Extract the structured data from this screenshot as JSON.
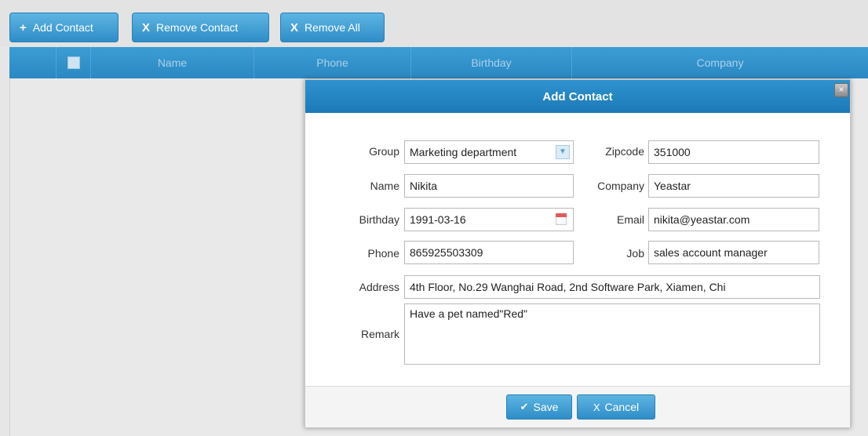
{
  "toolbar": {
    "add_contact": {
      "icon": "+",
      "label": "Add Contact"
    },
    "remove_contact": {
      "icon": "X",
      "label": "Remove Contact"
    },
    "remove_all": {
      "icon": "X",
      "label": "Remove All"
    }
  },
  "grid": {
    "columns": [
      "Name",
      "Phone",
      "Birthday",
      "Company"
    ]
  },
  "dialog": {
    "title": "Add Contact",
    "close_icon": "×",
    "fields": {
      "group": {
        "label": "Group",
        "value": "Marketing department"
      },
      "zipcode": {
        "label": "Zipcode",
        "value": "351000"
      },
      "name": {
        "label": "Name",
        "value": "Nikita"
      },
      "company": {
        "label": "Company",
        "value": "Yeastar"
      },
      "birthday": {
        "label": "Birthday",
        "value": "1991-03-16"
      },
      "email": {
        "label": "Email",
        "value": "nikita@yeastar.com"
      },
      "phone": {
        "label": "Phone",
        "value": "865925503309"
      },
      "job": {
        "label": "Job",
        "value": "sales account manager"
      },
      "address": {
        "label": "Address",
        "value": "4th Floor, No.29 Wanghai Road, 2nd Software Park, Xiamen, Chi"
      },
      "remark": {
        "label": "Remark",
        "value": "Have a pet named\"Red\""
      }
    },
    "save": {
      "icon": "✔",
      "label": "Save"
    },
    "cancel": {
      "icon": "X",
      "label": "Cancel"
    }
  },
  "colors": {
    "accent": "#2f8dc7",
    "header": "#2b88c2",
    "title_bar": "#1c79b8"
  }
}
